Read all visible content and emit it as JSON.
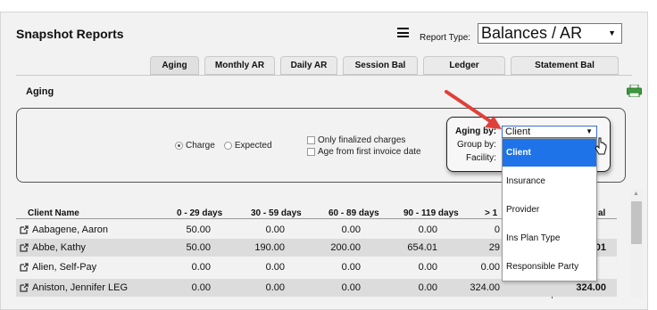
{
  "header": {
    "title": "Snapshot Reports",
    "report_type_label": "Report Type:",
    "report_type_value": "Balances / AR"
  },
  "tabs": [
    {
      "label": "Aging",
      "active": true
    },
    {
      "label": "Monthly AR"
    },
    {
      "label": "Daily AR"
    },
    {
      "label": "Session Bal"
    },
    {
      "label": "Ledger"
    },
    {
      "label": "Statement Bal"
    }
  ],
  "section": {
    "title": "Aging"
  },
  "filters": {
    "radio_charge": "Charge",
    "radio_expected": "Expected",
    "check_finalized": "Only finalized charges",
    "check_first_invoice": "Age from first invoice date",
    "aging_by_label": "Aging by:",
    "aging_by_value": "Client",
    "group_by_label": "Group by:",
    "facility_label": "Facility:",
    "dropdown_options": [
      "Client",
      "Insurance",
      "Provider",
      "Ins Plan Type",
      "Responsible Party"
    ]
  },
  "table": {
    "headers": [
      "Client Name",
      "0 - 29 days",
      "30 - 59 days",
      "60 - 89 days",
      "90 - 119 days",
      "> 1",
      "al"
    ],
    "rows": [
      {
        "name": "Aabagene, Aaron",
        "c0": "50.00",
        "c1": "0.00",
        "c2": "0.00",
        "c3": "0.00",
        "c4": "0",
        "total": ""
      },
      {
        "name": "Abbe, Kathy",
        "c0": "50.00",
        "c1": "190.00",
        "c2": "200.00",
        "c3": "654.01",
        "c4": "29",
        "total": "01"
      },
      {
        "name": "Alien, Self-Pay",
        "c0": "0.00",
        "c1": "0.00",
        "c2": "0.00",
        "c3": "0.00",
        "c4": "0.00",
        "total": ""
      },
      {
        "name": "Aniston, Jennifer LEG",
        "c0": "0.00",
        "c1": "0.00",
        "c2": "0.00",
        "c3": "0.00",
        "c4": "324.00",
        "total": "324.00"
      }
    ]
  },
  "colors": {
    "accent": "#1e73e8",
    "arrow": "#e0403a",
    "printer": "#3c9a3c"
  }
}
